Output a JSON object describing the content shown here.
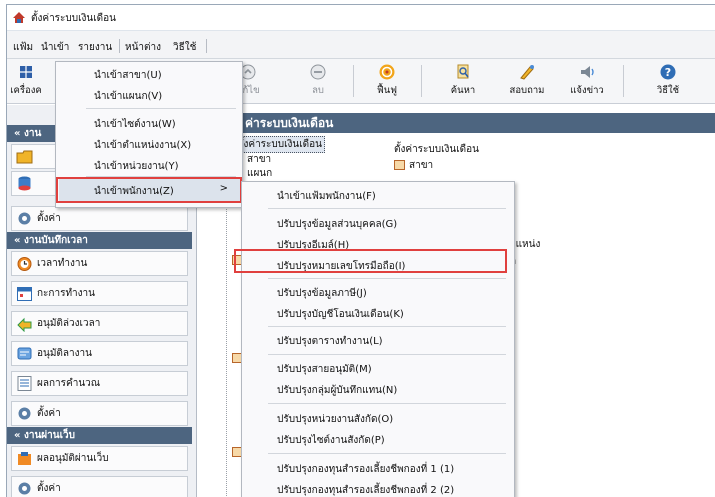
{
  "window": {
    "title": "ตั้งค่าระบบเงินเดือน"
  },
  "menubar": [
    "แฟ้ม",
    "นำเข้า",
    "รายงาน",
    "หน้าต่าง",
    "วิธีใช้"
  ],
  "toolbar": {
    "left_label": "เครื่องค",
    "buttons": [
      {
        "label": "แก้ไข",
        "icon": "edit-icon",
        "disabled": true
      },
      {
        "label": "ลบ",
        "icon": "delete-icon",
        "disabled": true
      },
      {
        "label": "ฟื้นฟู",
        "icon": "refresh-icon",
        "disabled": false
      },
      {
        "label": "ค้นหา",
        "icon": "search-icon",
        "disabled": false
      },
      {
        "label": "สอบถาม",
        "icon": "inquiry-icon",
        "disabled": false
      },
      {
        "label": "แจ้งข่าว",
        "icon": "announce-icon",
        "disabled": false
      },
      {
        "label": "วิธีใช้",
        "icon": "help-icon",
        "disabled": false
      }
    ]
  },
  "left_panel": {
    "section1_head": "งาน",
    "setup_label": "ตั้งค่า",
    "section2_head": "งานบันทึกเวลา",
    "time_items": [
      "เวลาทำงาน",
      "กะการทำงาน",
      "อนุมัติล่วงเวลา",
      "อนุมัติลางาน",
      "ผลการคำนวณ",
      "ตั้งค่า"
    ],
    "section3_head": "งานผ่านเว็บ",
    "web_items": [
      "ผลอนุมัติผ่านเว็บ",
      "ตั้งค่า"
    ]
  },
  "right_panel": {
    "header": "ค่าระบบเงินเดือน",
    "tree": {
      "root": "ตั้งค่าระบบเงินเดือน",
      "branch": "สาขา",
      "dept": "แผนก"
    },
    "detail": {
      "title": "ตั้งค่าระบบเงินเดือน",
      "branch": "สาขา",
      "position_tail": "าแหน่ง",
      "tail_k": "ก"
    }
  },
  "import_menu": {
    "items": [
      "นำเข้าสาขา(U)",
      "นำเข้าแผนก(V)",
      "นำเข้าไซต์งาน(W)",
      "นำเข้าตำแหน่งงาน(X)",
      "นำเข้าหน่วยงาน(Y)",
      "นำเข้าพนักงาน(Z)"
    ],
    "submenu_arrow": ">"
  },
  "employee_submenu": {
    "items": [
      "นำเข้าแฟ้มพนักงาน(F)",
      "ปรับปรุงข้อมูลส่วนบุคคล(G)",
      "ปรับปรุงอีเมล์(H)",
      "ปรับปรุงหมายเลขโทรมือถือ(I)",
      "ปรับปรุงข้อมูลภาษี(J)",
      "ปรับปรุงบัญชีโอนเงินเดือน(K)",
      "ปรับปรุงตารางทำงาน(L)",
      "ปรับปรุงสายอนุมัติ(M)",
      "ปรับปรุงกลุ่มผู้บันทึกแทน(N)",
      "ปรับปรุงหน่วยงานสังกัด(O)",
      "ปรับปรุงไซต์งานสังกัด(P)",
      "ปรับปรุงกองทุนสำรองเลี้ยงชีพกองที่ 1 (1)",
      "ปรับปรุงกองทุนสำรองเลี้ยงชีพกองที่ 2 (2)"
    ]
  },
  "colors": {
    "highlight_box": "#e0403e",
    "panel_header": "#4d6580"
  }
}
